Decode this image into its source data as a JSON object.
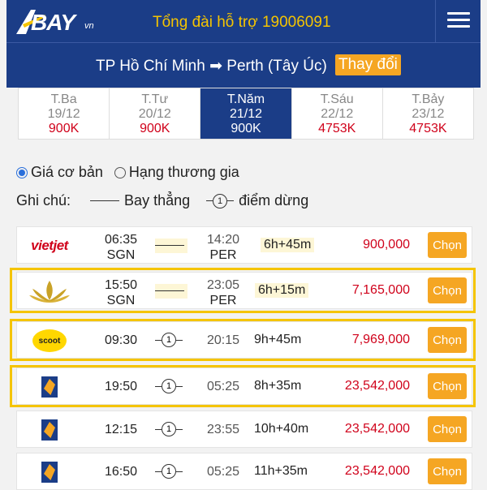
{
  "header": {
    "logo_text": "BAY",
    "logo_suffix": "vn",
    "hotline": "Tổng đài hỗ trợ 19006091"
  },
  "route": {
    "text": "TP Hồ Chí Minh ➡ Perth (Tây Úc)",
    "change_label": "Thay đổi"
  },
  "dates": [
    {
      "day": "T.Ba",
      "date": "19/12",
      "price": "900K"
    },
    {
      "day": "T.Tư",
      "date": "20/12",
      "price": "900K"
    },
    {
      "day": "T.Năm",
      "date": "21/12",
      "price": "900K"
    },
    {
      "day": "T.Sáu",
      "date": "22/12",
      "price": "4753K"
    },
    {
      "day": "T.Bảy",
      "date": "23/12",
      "price": "4753K"
    }
  ],
  "options": {
    "basic": "Giá cơ bản",
    "business": "Hạng thương gia"
  },
  "legend": {
    "label": "Ghi chú:",
    "direct": "Bay thẳng",
    "stop_num": "1",
    "stop": "điểm dừng"
  },
  "flights": [
    {
      "airline": "vietjet",
      "logo_text": "vietjet",
      "dep_time": "06:35",
      "dep_code": "SGN",
      "arr_time": "14:20",
      "arr_code": "PER",
      "duration": "6h+45m",
      "price": "900,000",
      "button": "Chọn"
    },
    {
      "airline": "vietnam-airlines",
      "dep_time": "15:50",
      "dep_code": "SGN",
      "arr_time": "23:05",
      "arr_code": "PER",
      "duration": "6h+15m",
      "price": "7,165,000",
      "button": "Chọn"
    },
    {
      "airline": "scoot",
      "logo_text": "scoot",
      "dep_time": "09:30",
      "arr_time": "20:15",
      "stop": "1",
      "duration": "9h+45m",
      "price": "7,969,000",
      "button": "Chọn"
    },
    {
      "airline": "singapore-airlines",
      "dep_time": "19:50",
      "arr_time": "05:25",
      "stop": "1",
      "duration": "8h+35m",
      "price": "23,542,000",
      "button": "Chọn"
    },
    {
      "airline": "singapore-airlines",
      "dep_time": "12:15",
      "arr_time": "23:55",
      "stop": "1",
      "duration": "10h+40m",
      "price": "23,542,000",
      "button": "Chọn"
    },
    {
      "airline": "singapore-airlines",
      "dep_time": "16:50",
      "arr_time": "05:25",
      "stop": "1",
      "duration": "11h+35m",
      "price": "23,542,000",
      "button": "Chọn"
    }
  ],
  "colors": {
    "header": "#1b3d87",
    "accent": "#f5a623",
    "price": "#d0021b",
    "highlight": "#f5c400"
  }
}
